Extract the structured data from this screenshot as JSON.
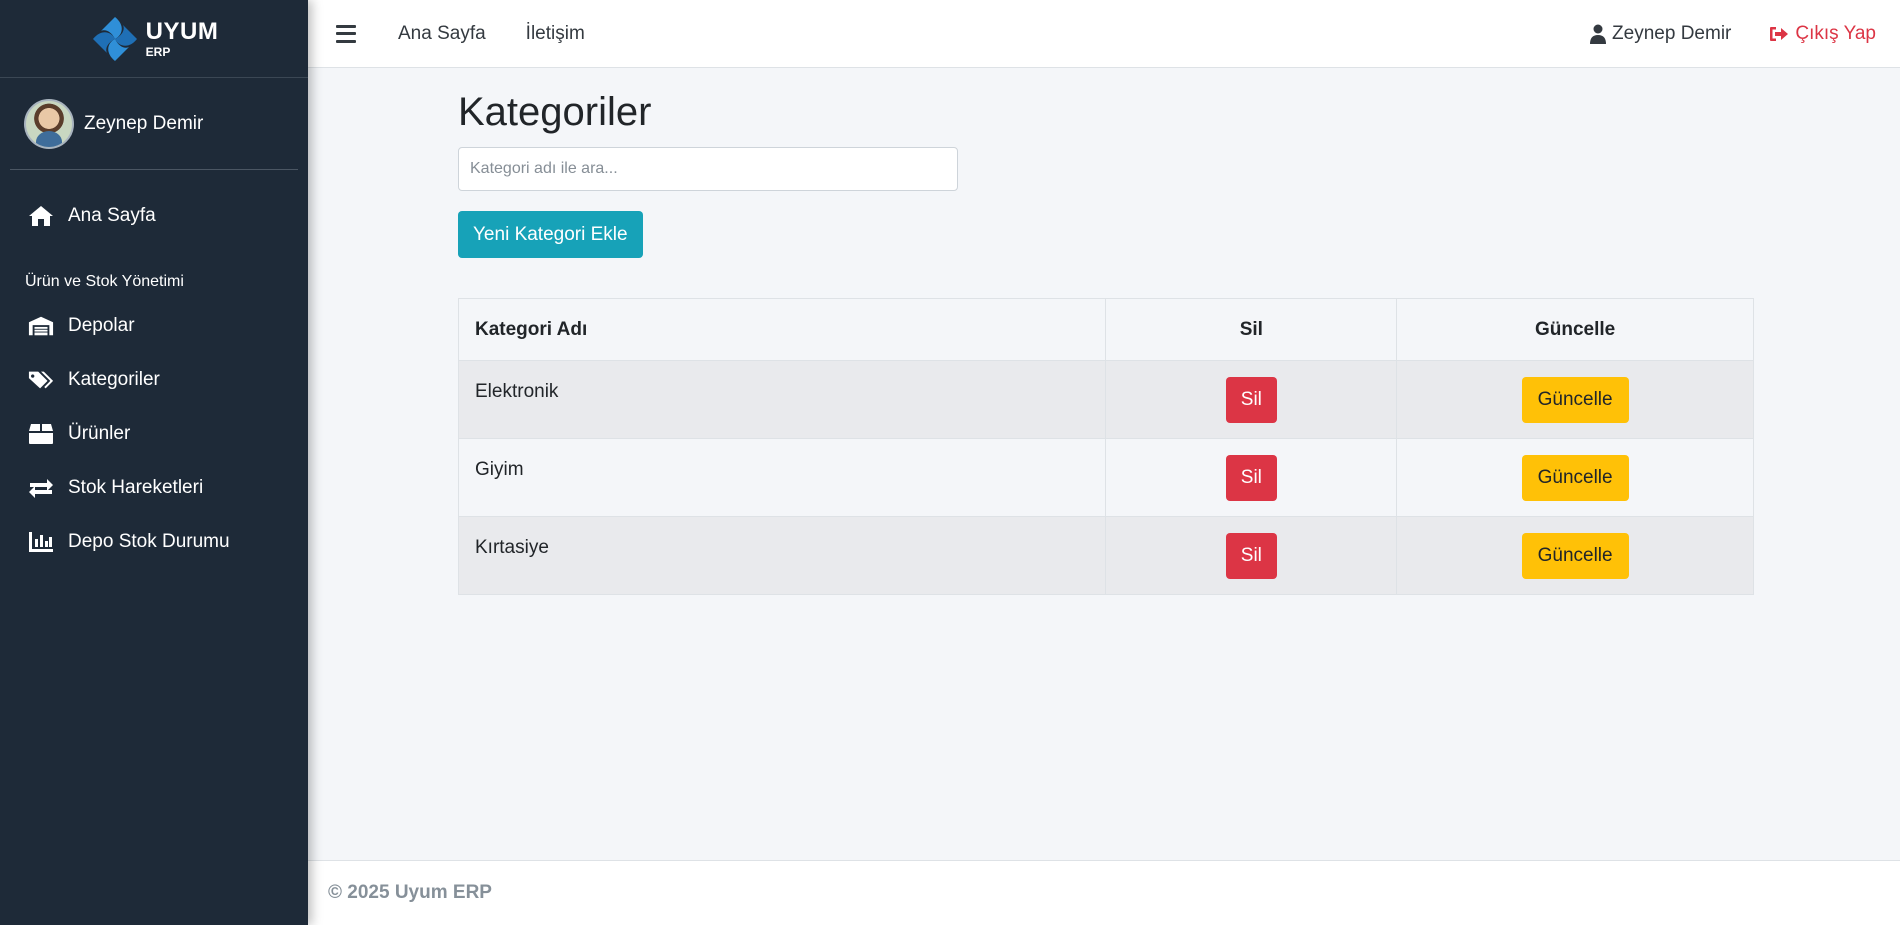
{
  "brand": {
    "name": "UYUM",
    "sub": "ERP",
    "logo_icon": "diamond-swirl-logo",
    "logo_color": "#2f8fd8"
  },
  "sidebar": {
    "user_name": "Zeynep Demir",
    "items": [
      {
        "label": "Ana Sayfa",
        "icon": "home-icon"
      },
      {
        "label": "Depolar",
        "icon": "warehouse-icon"
      },
      {
        "label": "Kategoriler",
        "icon": "tags-icon"
      },
      {
        "label": "Ürünler",
        "icon": "box-icon"
      },
      {
        "label": "Stok Hareketleri",
        "icon": "exchange-icon"
      },
      {
        "label": "Depo Stok Durumu",
        "icon": "bar-chart-icon"
      }
    ],
    "section_header": "Ürün ve Stok Yönetimi"
  },
  "topbar": {
    "links": [
      "Ana Sayfa",
      "İletişim"
    ],
    "user_name": "Zeynep Demir",
    "logout_label": "Çıkış Yap"
  },
  "main": {
    "title": "Kategoriler",
    "search_placeholder": "Kategori adı ile ara...",
    "add_button": "Yeni Kategori Ekle",
    "table": {
      "headers": [
        "Kategori Adı",
        "Sil",
        "Güncelle"
      ],
      "rows": [
        {
          "name": "Elektronik",
          "delete": "Sil",
          "update": "Güncelle"
        },
        {
          "name": "Giyim",
          "delete": "Sil",
          "update": "Güncelle"
        },
        {
          "name": "Kırtasiye",
          "delete": "Sil",
          "update": "Güncelle"
        }
      ]
    }
  },
  "footer": {
    "text": "© 2025 Uyum ERP"
  },
  "colors": {
    "sidebar_bg": "#1e2a38",
    "info": "#17a2b8",
    "danger": "#dc3545",
    "warning": "#ffc107"
  }
}
